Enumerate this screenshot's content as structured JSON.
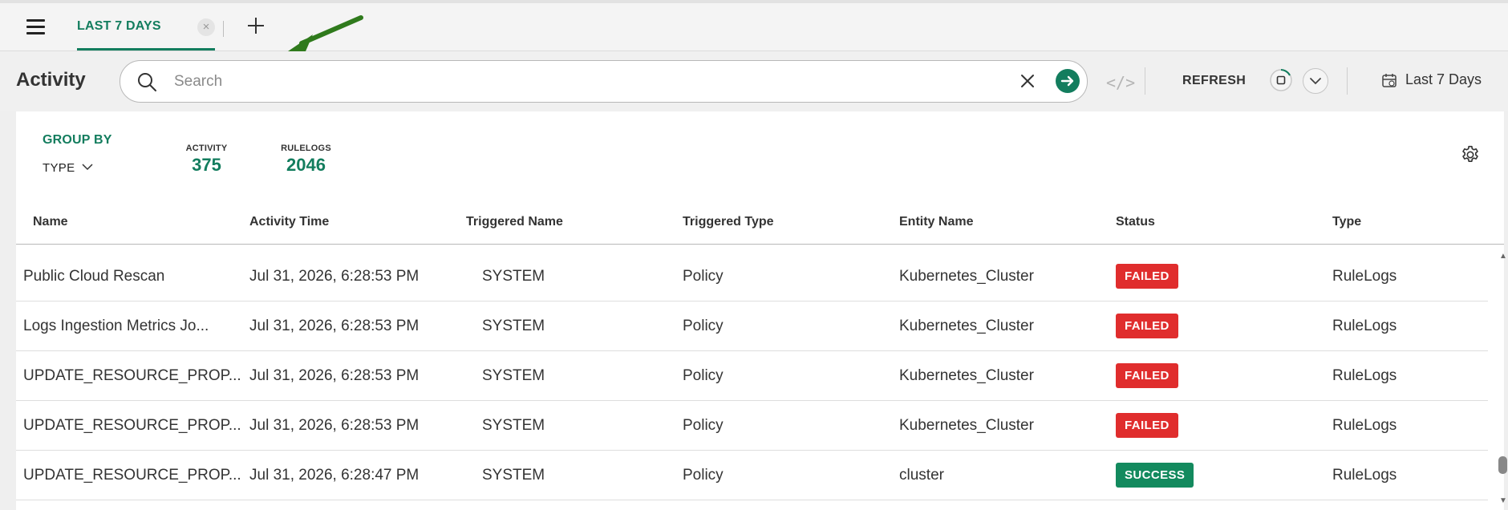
{
  "tabs": {
    "active_label": "LAST 7 DAYS",
    "close_symbol": "×"
  },
  "header": {
    "title": "Activity",
    "search_placeholder": "Search",
    "search_value": "",
    "code_toggle": "</>",
    "refresh_label": "REFRESH",
    "date_range_label": "Last 7 Days"
  },
  "summary": {
    "group_by_label": "GROUP BY",
    "group_by_value": "TYPE",
    "stats": [
      {
        "label": "ACTIVITY",
        "value": "375"
      },
      {
        "label": "RULELOGS",
        "value": "2046"
      }
    ]
  },
  "table": {
    "columns": [
      "Name",
      "Activity Time",
      "Triggered Name",
      "Triggered Type",
      "Entity Name",
      "Status",
      "Type"
    ],
    "rows": [
      {
        "name": "Public Cloud Rescan",
        "time": "Jul 31, 2026, 6:28:53 PM",
        "triggered_name": "SYSTEM",
        "triggered_type": "Policy",
        "entity": "Kubernetes_Cluster",
        "status": "FAILED",
        "type": "RuleLogs"
      },
      {
        "name": "Logs Ingestion Metrics Jo...",
        "time": "Jul 31, 2026, 6:28:53 PM",
        "triggered_name": "SYSTEM",
        "triggered_type": "Policy",
        "entity": "Kubernetes_Cluster",
        "status": "FAILED",
        "type": "RuleLogs"
      },
      {
        "name": "UPDATE_RESOURCE_PROP...",
        "time": "Jul 31, 2026, 6:28:53 PM",
        "triggered_name": "SYSTEM",
        "triggered_type": "Policy",
        "entity": "Kubernetes_Cluster",
        "status": "FAILED",
        "type": "RuleLogs"
      },
      {
        "name": "UPDATE_RESOURCE_PROP...",
        "time": "Jul 31, 2026, 6:28:53 PM",
        "triggered_name": "SYSTEM",
        "triggered_type": "Policy",
        "entity": "Kubernetes_Cluster",
        "status": "FAILED",
        "type": "RuleLogs"
      },
      {
        "name": "UPDATE_RESOURCE_PROP...",
        "time": "Jul 31, 2026, 6:28:47 PM",
        "triggered_name": "SYSTEM",
        "triggered_type": "Policy",
        "entity": "cluster",
        "status": "SUCCESS",
        "type": "RuleLogs"
      }
    ]
  },
  "colors": {
    "accent": "#137d5e",
    "failed": "#e02d2d",
    "success": "#138a5e",
    "annotation_arrow": "#2f7a1c"
  },
  "icons": [
    "menu-icon",
    "close-icon",
    "plus-icon",
    "arrow-annotation",
    "search-icon",
    "clear-icon",
    "arrow-right-icon",
    "code-icon",
    "auto-refresh-icon",
    "chevron-down-icon",
    "calendar-icon",
    "gear-icon"
  ]
}
